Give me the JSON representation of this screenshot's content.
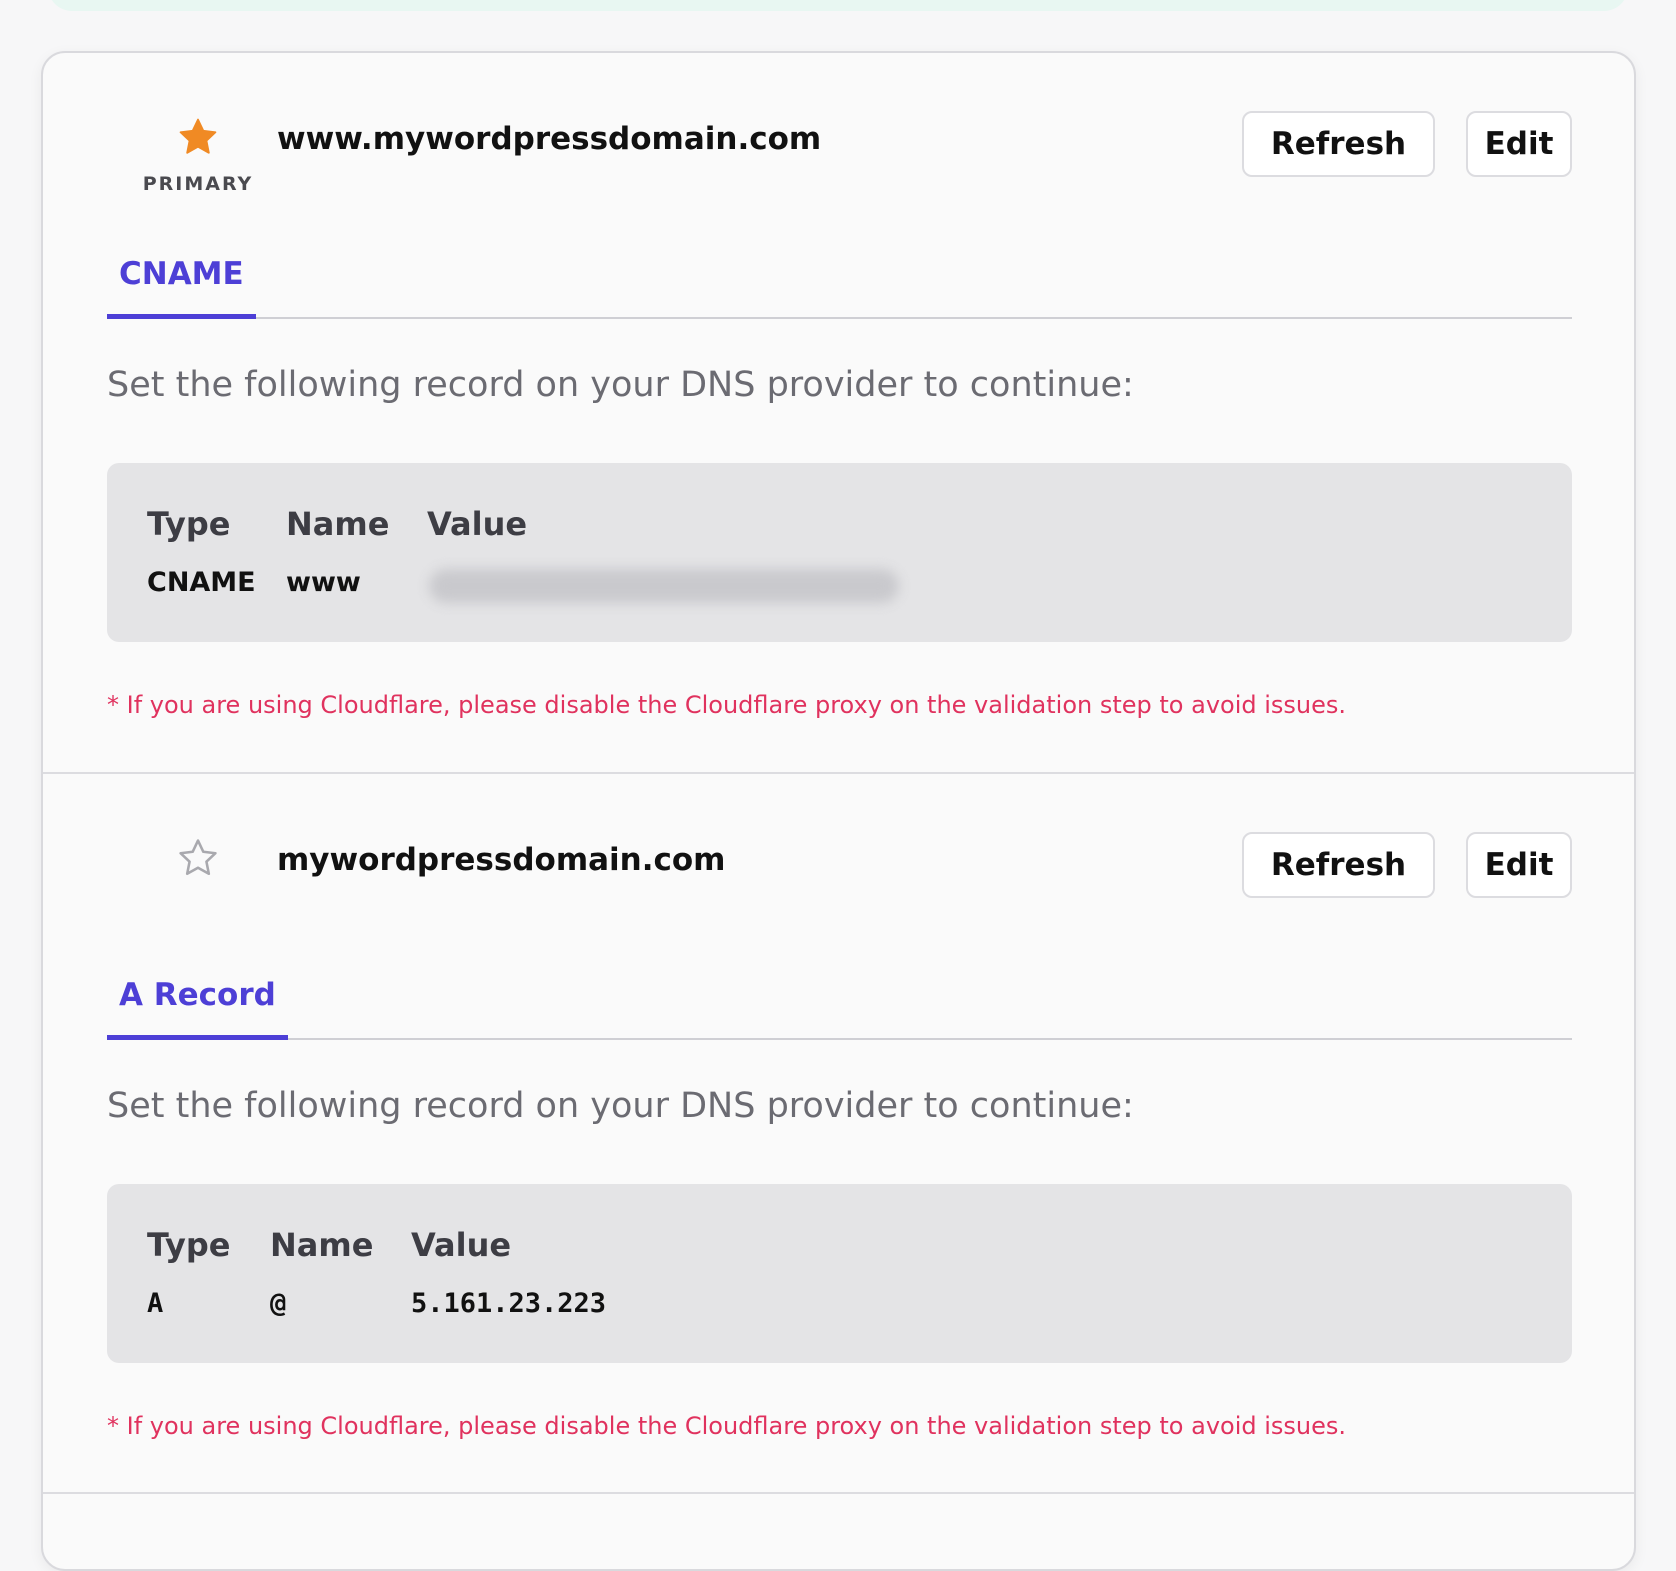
{
  "domains": [
    {
      "name": "www.mywordpressdomain.com",
      "primary": true,
      "primary_label": "PRIMARY",
      "refresh_label": "Refresh",
      "edit_label": "Edit",
      "tab_label": "CNAME",
      "instruction": "Set the following record on your DNS provider to continue:",
      "record": {
        "headers": {
          "type": "Type",
          "name": "Name",
          "value": "Value"
        },
        "type": "CNAME",
        "name": "www",
        "value": ""
      },
      "note": "* If you are using Cloudflare, please disable the Cloudflare proxy on the validation step to avoid issues."
    },
    {
      "name": "mywordpressdomain.com",
      "primary": false,
      "refresh_label": "Refresh",
      "edit_label": "Edit",
      "tab_label": "A Record",
      "instruction": "Set the following record on your DNS provider to continue:",
      "record": {
        "headers": {
          "type": "Type",
          "name": "Name",
          "value": "Value"
        },
        "type": "A",
        "name": "@",
        "value": "5.161.23.223"
      },
      "note": "* If you are using Cloudflare, please disable the Cloudflare proxy on the validation step to avoid issues."
    }
  ],
  "colors": {
    "accent": "#4d3fd6",
    "star_filled": "#f08a24",
    "note": "#e0325e"
  },
  "icons": [
    "star-filled-icon",
    "star-outline-icon"
  ]
}
